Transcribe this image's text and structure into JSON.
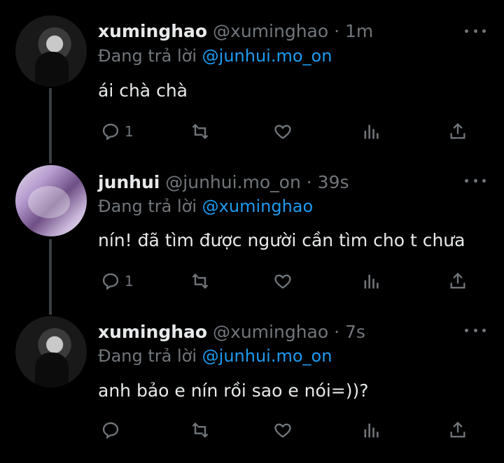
{
  "replying_prefix": "Đang trả lời",
  "tweets": [
    {
      "name": "xuminghao",
      "handle": "@xuminghao",
      "time": "· 1m",
      "reply_to": "@junhui.mo_on",
      "text": "ái chà chà",
      "reply_count": "1"
    },
    {
      "name": "junhui",
      "handle": "@junhui.mo_on",
      "time": "· 39s",
      "reply_to": "@xuminghao",
      "text": "nín! đã tìm được người cần tìm cho t chưa",
      "reply_count": "1"
    },
    {
      "name": "xuminghao",
      "handle": "@xuminghao",
      "time": "· 7s",
      "reply_to": "@junhui.mo_on",
      "text": "anh bảo e nín rồi sao e nói=))?",
      "reply_count": ""
    }
  ],
  "icons": [
    "reply-icon",
    "retweet-icon",
    "like-icon",
    "views-icon",
    "share-icon",
    "more-icon"
  ],
  "colors": {
    "background": "#000000",
    "text": "#e7e9ea",
    "muted": "#71767b",
    "link": "#1d9bf0"
  }
}
